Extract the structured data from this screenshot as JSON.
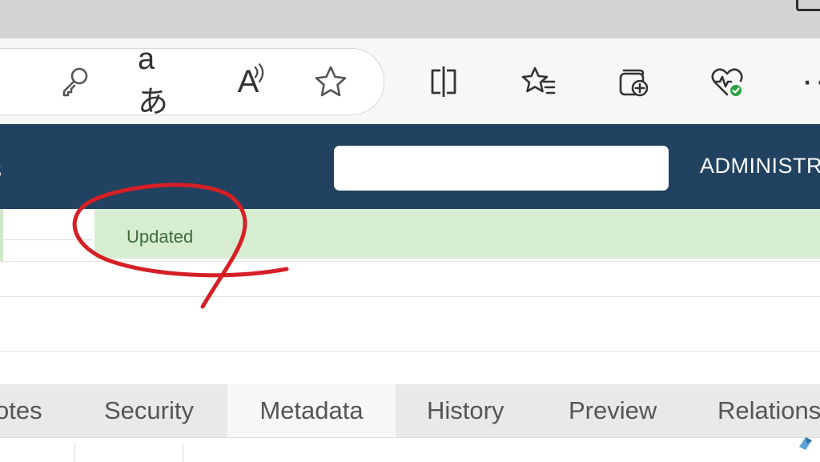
{
  "browser": {
    "toolbar_icons": [
      "key-icon",
      "read-aloud-text-icon",
      "read-aloud-icon",
      "favorite-star-icon",
      "split-screen-icon",
      "favorites-icon",
      "collections-icon",
      "browser-essentials-icon",
      "more-icon"
    ],
    "translate_glyph": "aあ",
    "read_aloud_glyph": "A",
    "more_glyph": "··"
  },
  "app": {
    "header_stub": "s",
    "search": {
      "value": "",
      "placeholder": ""
    },
    "user_label": "ADMINISTR",
    "status_text": "Updated",
    "colors": {
      "navbar": "#214260",
      "status_bg": "#d7edd1",
      "annotation": "#d61f26"
    }
  },
  "tabs": [
    {
      "label": "otes"
    },
    {
      "label": "Security"
    },
    {
      "label": "Metadata",
      "active": true
    },
    {
      "label": "History"
    },
    {
      "label": "Preview"
    },
    {
      "label": "Relations"
    }
  ]
}
